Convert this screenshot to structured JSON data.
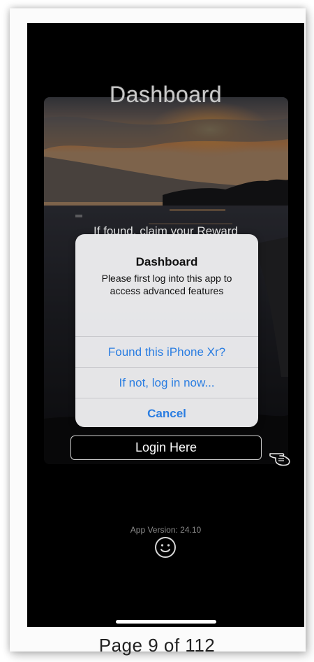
{
  "app": {
    "title": "Dashboard",
    "reward_text": "If found, claim your Reward",
    "alert": {
      "title": "Dashboard",
      "message": "Please first log into this app to access advanced features",
      "buttons": [
        "Found this iPhone Xr?",
        "If not, log in now...",
        "Cancel"
      ]
    },
    "login_label": "Login Here",
    "version": "App Version: 24.10"
  },
  "page_footer": "Page 9 of 112",
  "colors": {
    "accent": "#2a7de1",
    "background": "#000000"
  }
}
